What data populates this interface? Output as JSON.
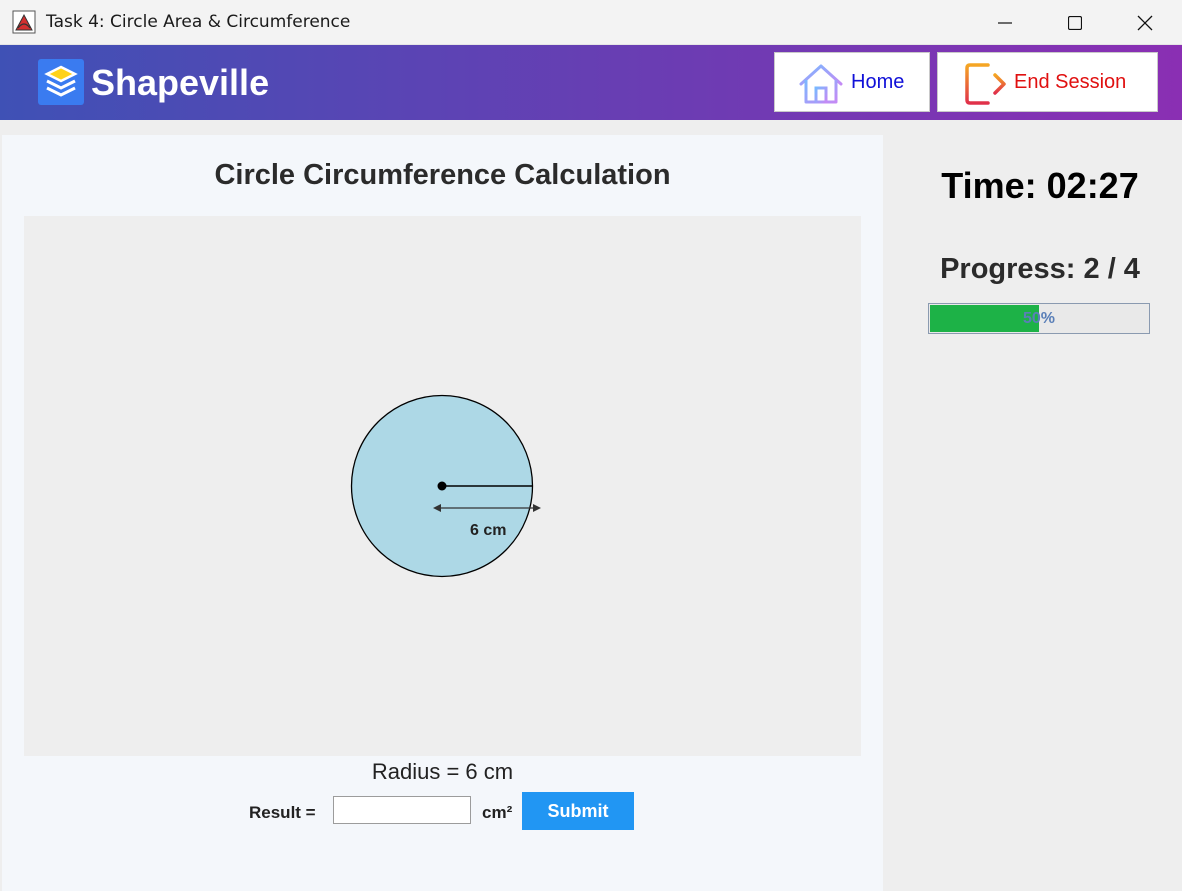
{
  "window": {
    "title": "Task 4: Circle Area & Circumference"
  },
  "header": {
    "brand": "Shapeville",
    "home_label": "Home",
    "end_session_label": "End Session"
  },
  "task": {
    "title": "Circle Circumference Calculation",
    "radius_label": "6 cm",
    "radius_text": "Radius = 6 cm",
    "result_label": "Result =",
    "result_value": "",
    "unit": "cm²",
    "submit_label": "Submit"
  },
  "status": {
    "timer": "Time: 02:27",
    "progress_label": "Progress: 2 / 4",
    "progress_fraction": 0.5,
    "progress_text": "50%"
  },
  "colors": {
    "circle_fill": "#add8e6",
    "progress_fill": "#1db247",
    "submit": "#2196f3"
  },
  "icons": {
    "app": "java-app-icon",
    "logo": "layers-icon",
    "home": "home-icon",
    "end_session": "exit-icon"
  }
}
